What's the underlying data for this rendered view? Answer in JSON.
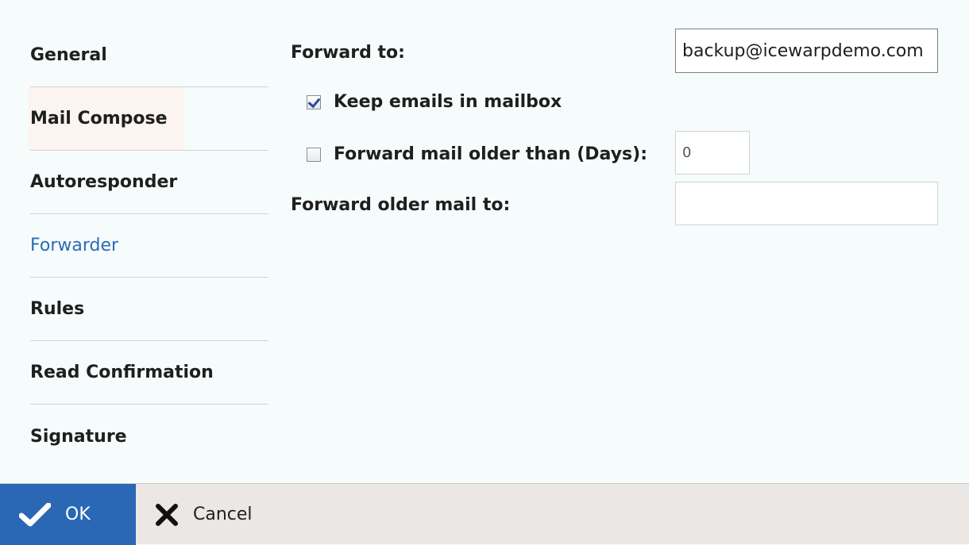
{
  "sidebar": {
    "items": [
      {
        "label": "General"
      },
      {
        "label": "Mail Compose"
      },
      {
        "label": "Autoresponder"
      },
      {
        "label": "Forwarder"
      },
      {
        "label": "Rules"
      },
      {
        "label": "Read Confirmation"
      },
      {
        "label": "Signature"
      }
    ],
    "active": "Forwarder"
  },
  "form": {
    "forward_to_label": "Forward to:",
    "forward_to_value": "backup@icewarpdemo.com",
    "keep_emails_label": "Keep emails in mailbox",
    "keep_emails_checked": true,
    "forward_older_label": "Forward mail older than (Days):",
    "forward_older_checked": false,
    "days_value": "0",
    "forward_older_to_label": "Forward older mail to:",
    "forward_older_to_value": ""
  },
  "footer": {
    "ok_label": "OK",
    "cancel_label": "Cancel"
  },
  "colors": {
    "accent": "#2a67b4",
    "active_nav": "#2b6cb5",
    "footer_bg": "#ebe7e4"
  }
}
